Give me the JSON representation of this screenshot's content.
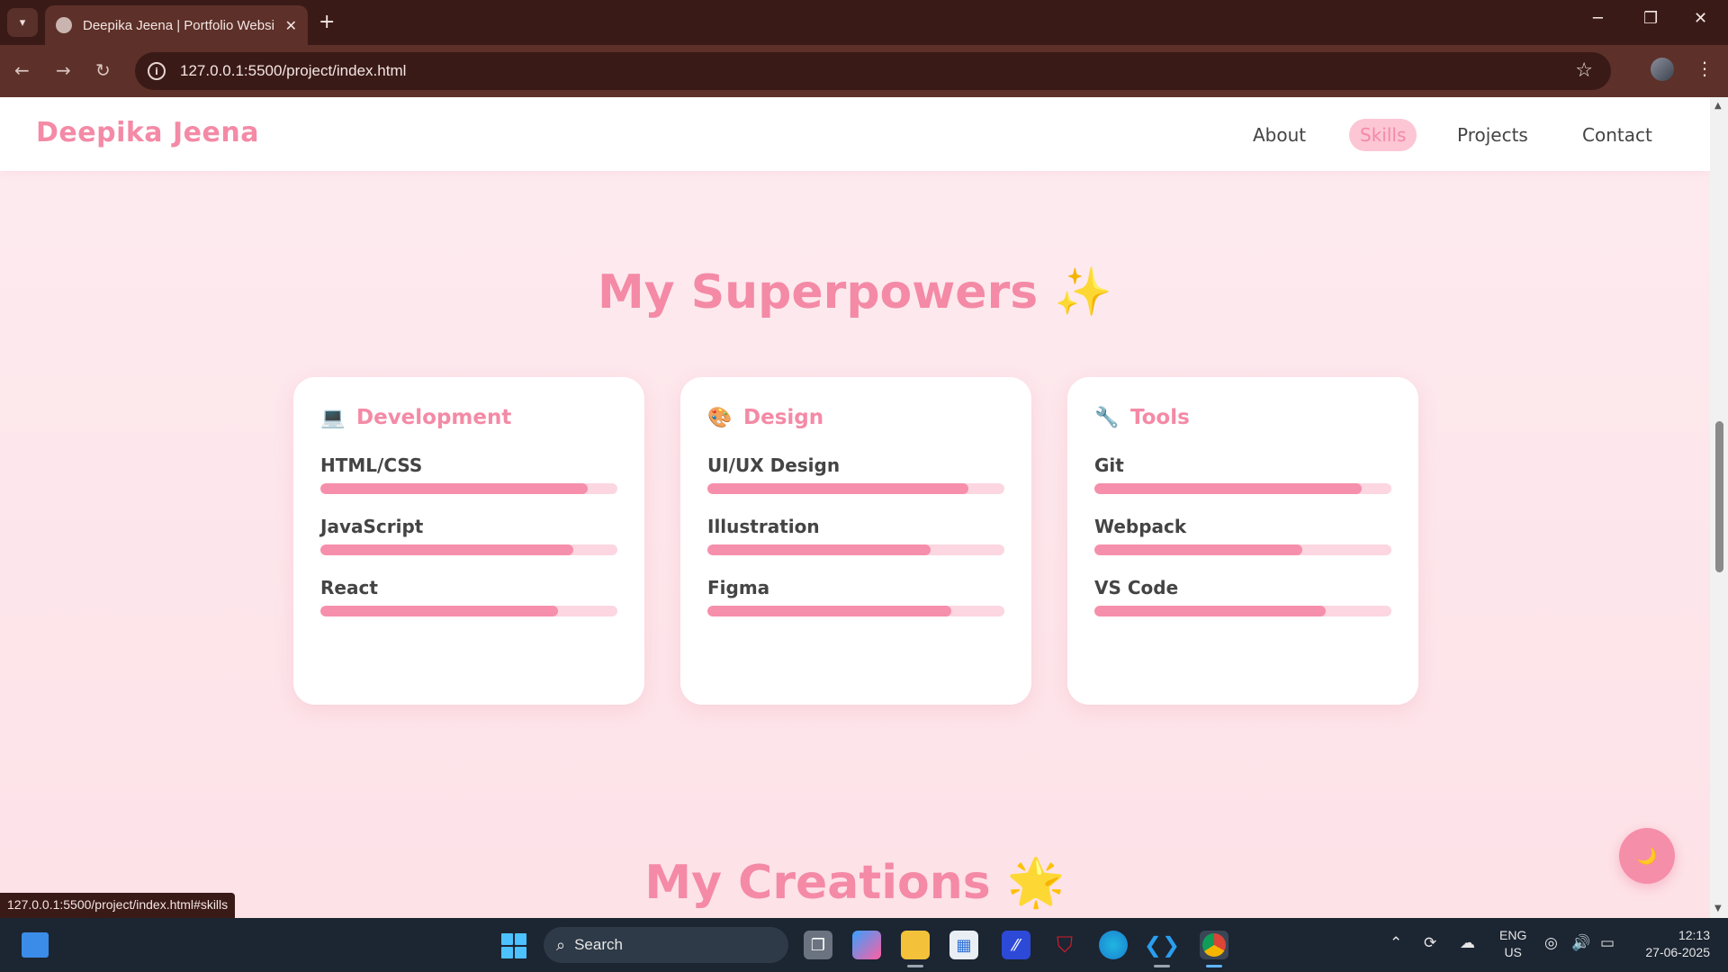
{
  "browser": {
    "tab_title": "Deepika Jeena | Portfolio Websi",
    "url": "127.0.0.1:5500/project/index.html",
    "status_url": "127.0.0.1:5500/project/index.html#skills"
  },
  "site": {
    "logo": "Deepika Jeena",
    "nav": [
      {
        "label": "About",
        "active": false
      },
      {
        "label": "Skills",
        "active": true
      },
      {
        "label": "Projects",
        "active": false
      },
      {
        "label": "Contact",
        "active": false
      }
    ]
  },
  "skills_section": {
    "title": "My Superpowers ✨",
    "cards": [
      {
        "icon": "💻",
        "icon_name": "laptop-icon",
        "title": "Development",
        "skills": [
          {
            "name": "HTML/CSS",
            "level": 0.9
          },
          {
            "name": "JavaScript",
            "level": 0.85
          },
          {
            "name": "React",
            "level": 0.8
          }
        ]
      },
      {
        "icon": "🎨",
        "icon_name": "palette-icon",
        "title": "Design",
        "skills": [
          {
            "name": "UI/UX Design",
            "level": 0.88
          },
          {
            "name": "Illustration",
            "level": 0.75
          },
          {
            "name": "Figma",
            "level": 0.82
          }
        ]
      },
      {
        "icon": "🔧",
        "icon_name": "wrench-icon",
        "title": "Tools",
        "skills": [
          {
            "name": "Git",
            "level": 0.9
          },
          {
            "name": "Webpack",
            "level": 0.7
          },
          {
            "name": "VS Code",
            "level": 0.78
          }
        ]
      }
    ]
  },
  "projects_section": {
    "title": "My Creations 🌟"
  },
  "theme_toggle": {
    "icon": "🌙",
    "icon_name": "moon-icon"
  },
  "colors": {
    "accent": "#f48aa6",
    "bar_fill": "#f68fab",
    "bar_track": "#fcd6e0",
    "page_bg": "#fdebef",
    "chrome_bg": "#3a1a17"
  },
  "taskbar": {
    "search_label": "Search",
    "lang_top": "ENG",
    "lang_bottom": "US",
    "time": "12:13",
    "date": "27-06-2025"
  }
}
